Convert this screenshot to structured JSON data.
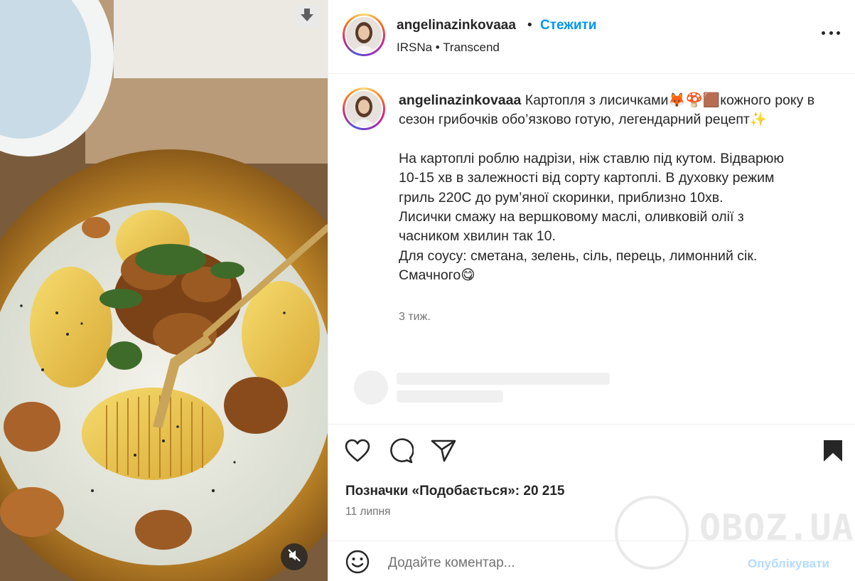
{
  "post": {
    "username": "angelinazinkovaaa",
    "separator": "•",
    "follow_label": "Стежити",
    "audio_label": "IRSNa • Transcend",
    "caption_lines": [
      "Картопля з лисичками🦊🍄🟫кожного року в",
      "сезон грибочків обо’язково готую, легендарний рецепт✨",
      "",
      "На картоплі роблю надрізи, ніж ставлю під кутом. Відварюю",
      "10-15 хв в залежності від сорту картоплі. В духовку режим",
      "гриль 220С до рум’яної скоринки, приблизно 10хв.",
      "Лисички смажу на вершковому маслі, оливковій олії з",
      "часником хвилин так 10.",
      "Для соусу: сметана, зелень, сіль, перець, лимонний сік.",
      "Смачного😋"
    ],
    "caption_time": "3 тиж.",
    "likes_label": "Позначки «Подобається»: 20 215",
    "post_date": "11 липня"
  },
  "comment": {
    "placeholder": "Додайте коментар...",
    "publish_label": "Опублікувати"
  },
  "watermark": {
    "text": "OBOZ.UA"
  },
  "icons": {
    "download": "download-arrow-icon",
    "mute": "speaker-muted-icon",
    "more": "more-options-icon",
    "like": "heart-icon",
    "comment": "comment-bubble-icon",
    "share": "paper-plane-icon",
    "save": "bookmark-icon",
    "emoji": "smiley-icon"
  },
  "colors": {
    "accent_blue": "#0095f6",
    "publish_disabled": "#b3dbff",
    "text_primary": "#262626",
    "text_secondary": "#737373"
  }
}
